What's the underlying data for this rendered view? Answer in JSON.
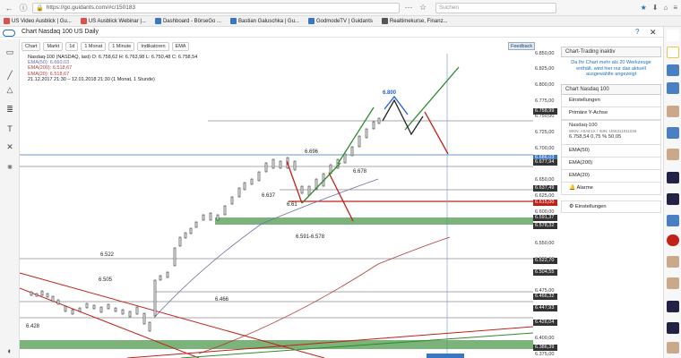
{
  "browser": {
    "url": "https://go.guidants.com/#c/150183",
    "search_placeholder": "Suchen"
  },
  "bookmarks": [
    {
      "label": "US Video Ausblick | Gu..."
    },
    {
      "label": "US Ausblick Webinar |..."
    },
    {
      "label": "Dashboard - BörseGo ..."
    },
    {
      "label": "Bastian Galuschka | Gu..."
    },
    {
      "label": "GodmodeTV | Guidants"
    },
    {
      "label": "Realtimekurse, Finanz..."
    }
  ],
  "chart": {
    "title": "Chart Nasdaq 100 US Daily",
    "toolbar": [
      "Chart",
      "Markt",
      "1d",
      "1 Monat",
      "1 Minute",
      "Indikatoren",
      "EMA"
    ],
    "feedback_label": "Feedback",
    "info_lines": [
      "Nasdaq-100 (NASDAQ, last)  O: 6.758,62  H: 6.763,98  L: 6.750,48  C: 6.758,54",
      "EMA(50): 6.660,03",
      "EMA(200): 6.518,67",
      "EMA(20): 6.518,67",
      "21.12.2017 21:30 – 12.01.2018 21:30  (1 Monat, 1 Stunde)"
    ],
    "annotations": [
      "6.800",
      "6.696",
      "6.678",
      "6.637",
      "6.61",
      "6.591-6.578",
      "6.522",
      "6.505",
      "6.466",
      "6.428"
    ],
    "colors": {
      "up": "#2f8a2f",
      "down": "#c0221a",
      "accent": "#1f5fd0",
      "zone": "#4f9a4f",
      "ema_slow": "#6f6fa8",
      "ema_fast": "#b03a3a"
    }
  },
  "y_axis": {
    "labels": [
      "6.850,00",
      "6.825,00",
      "6.800,00",
      "6.775,00",
      "6.758,99",
      "6.750,00",
      "6.725,00",
      "6.700,00",
      "6.686,03",
      "6.677,94",
      "6.650,00",
      "6.637,49",
      "6.625,00",
      "6.600,00",
      "6.591,37",
      "6.578,32",
      "6.550,00",
      "6.525,00",
      "6.522,70",
      "6.504,55",
      "6.475,00",
      "6.466,32",
      "6.447,93",
      "6.426,04",
      "6.400,00",
      "6.386,39",
      "6.375,00"
    ],
    "highlighted": [
      {
        "label": "6.758,99",
        "color": "#333333"
      },
      {
        "label": "6.686,03",
        "color": "#3a77c2"
      },
      {
        "label": "6.677,94",
        "color": "#333333"
      },
      {
        "label": "6.637,49",
        "color": "#333333"
      },
      {
        "label": "6.615,00",
        "color": "#c0221a"
      },
      {
        "label": "6.591,37",
        "color": "#333333"
      },
      {
        "label": "6.578,32",
        "color": "#333333"
      },
      {
        "label": "6.522,70",
        "color": "#333333"
      },
      {
        "label": "6.504,55",
        "color": "#333333"
      },
      {
        "label": "6.466,32",
        "color": "#333333"
      },
      {
        "label": "6.447,93",
        "color": "#333333"
      },
      {
        "label": "6.426,04",
        "color": "#333333"
      },
      {
        "label": "6.386,39",
        "color": "#333333"
      }
    ]
  },
  "panel": {
    "header": "Chart-Trading inaktiv",
    "note": "Da Ihr Chart mehr als 20 Werkzeuge enthält, wird hier nur das aktuell ausgewählte angezeigt",
    "section": "Chart Nasdaq 100",
    "rows": [
      "Einstellungen",
      "Primäre Y-Achse"
    ],
    "quote_name": "Nasdaq-100",
    "quote_sub": "WKN: A0AE1X / ISIN: US6311011026",
    "quote_vals": "6.758,54   0,75 %   50,05",
    "indicators": [
      "EMA(50)",
      "EMA(200)",
      "EMA(20)"
    ],
    "alarm": "Alarme",
    "settings": "Einstellungen"
  }
}
